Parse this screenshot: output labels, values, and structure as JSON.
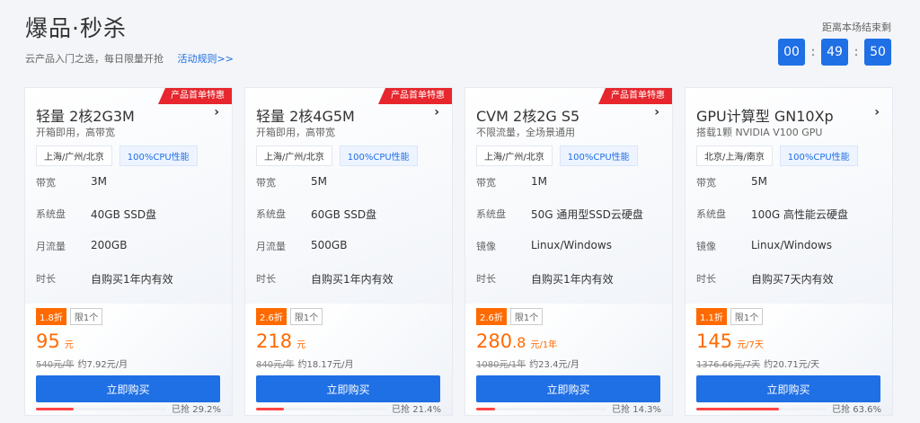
{
  "header": {
    "title": "爆品·秒杀",
    "subtitle": "云产品入门之选，每日限量开抢",
    "link": "活动规则>>"
  },
  "countdown": {
    "label": "距离本场结束剩",
    "hours": "00",
    "minutes": "49",
    "seconds": "50",
    "sep": ":"
  },
  "cards": [
    {
      "badge": "产品首单特惠",
      "title": "轻量 2核2G3M",
      "sub": "开箱即用，高带宽",
      "tags": [
        "上海/广州/北京",
        "100%CPU性能"
      ],
      "specs": [
        {
          "k": "带宽",
          "v": "3M"
        },
        {
          "k": "系统盘",
          "v": "40GB SSD盘"
        },
        {
          "k": "月流量",
          "v": "200GB"
        },
        {
          "k": "时长",
          "v": "自购买1年内有效"
        }
      ],
      "discount": "1.8折",
      "limit": "限1个",
      "price": "95",
      "price_unit": "元",
      "orig": "540元/年",
      "approx": "约7.92元/月",
      "buy": "立即购买",
      "sold": "已抢 29.2%",
      "progress": 0.292
    },
    {
      "badge": "产品首单特惠",
      "title": "轻量 2核4G5M",
      "sub": "开箱即用，高带宽",
      "tags": [
        "上海/广州/北京",
        "100%CPU性能"
      ],
      "specs": [
        {
          "k": "带宽",
          "v": "5M"
        },
        {
          "k": "系统盘",
          "v": "60GB SSD盘"
        },
        {
          "k": "月流量",
          "v": "500GB"
        },
        {
          "k": "时长",
          "v": "自购买1年内有效"
        }
      ],
      "discount": "2.6折",
      "limit": "限1个",
      "price": "218",
      "price_unit": "元",
      "orig": "840元/年",
      "approx": "约18.17元/月",
      "buy": "立即购买",
      "sold": "已抢 21.4%",
      "progress": 0.214
    },
    {
      "badge": "产品首单特惠",
      "title": "CVM 2核2G S5",
      "sub": "不限流量，全场景通用",
      "tags": [
        "上海/广州/北京",
        "100%CPU性能"
      ],
      "specs": [
        {
          "k": "带宽",
          "v": "1M"
        },
        {
          "k": "系统盘",
          "v": "50G 通用型SSD云硬盘"
        },
        {
          "k": "镜像",
          "v": "Linux/Windows"
        },
        {
          "k": "时长",
          "v": "自购买1年内有效"
        }
      ],
      "discount": "2.6折",
      "limit": "限1个",
      "price": "280",
      "price_dec": ".8",
      "price_unit": "元/1年",
      "orig": "1080元/1年",
      "approx": "约23.4元/月",
      "buy": "立即购买",
      "sold": "已抢 14.3%",
      "progress": 0.143
    },
    {
      "badge": "",
      "title": "GPU计算型 GN10Xp",
      "sub": "搭载1颗 NVIDIA V100 GPU",
      "tags": [
        "北京/上海/南京",
        "100%CPU性能"
      ],
      "specs": [
        {
          "k": "带宽",
          "v": "5M"
        },
        {
          "k": "系统盘",
          "v": "100G 高性能云硬盘"
        },
        {
          "k": "镜像",
          "v": "Linux/Windows"
        },
        {
          "k": "时长",
          "v": "自购买7天内有效"
        }
      ],
      "discount": "1.1折",
      "limit": "限1个",
      "price": "145",
      "price_unit": "元/7天",
      "orig": "1376.66元/7天",
      "approx": "约20.71元/天",
      "buy": "立即购买",
      "sold": "已抢 63.6%",
      "progress": 0.636
    }
  ]
}
